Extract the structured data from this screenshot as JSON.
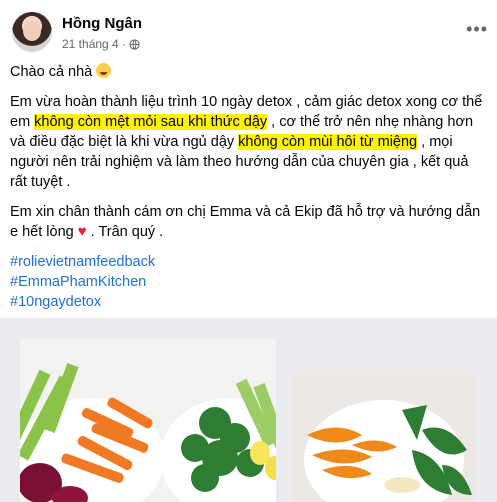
{
  "post": {
    "author": "Hồng Ngân",
    "date": "21 tháng 4",
    "separator": "·",
    "greeting": "Chào cả nhà",
    "para1": {
      "p1": "Em vừa hoàn thành liệu trình 10 ngày detox , cảm giác detox xong cơ thể em ",
      "h1": "không còn mệt mỏi sau khi thức dậy",
      "p2": " , cơ thể trở nên nhẹ nhàng hơn và điều đặc biệt là khi vừa ngủ dậy ",
      "h2": "không còn mùi hôi từ miệng",
      "p3": " , mọi người nên trải nghiệm và làm theo hướng dẫn của chuyên gia , kết quả rất tuyệt ."
    },
    "para2": {
      "text": "Em xin chân thành cám ơn chị Emma và cả Ekip đã hỗ trợ và hướng dẫn e hết lòng",
      "heart": "♥",
      "after": " . Trân quý ."
    },
    "hashtags": [
      "#rolievietnamfeedback",
      "#EmmaPhamKitchen",
      "#10ngaydetox"
    ]
  },
  "icons": [
    "globe-icon",
    "more-options-icon",
    "smiling-emoji-icon",
    "heart-icon"
  ],
  "colors": {
    "hashtag": "#216fdb",
    "highlight": "#fff200",
    "heart": "#e41e3f",
    "meta": "#65676b"
  }
}
